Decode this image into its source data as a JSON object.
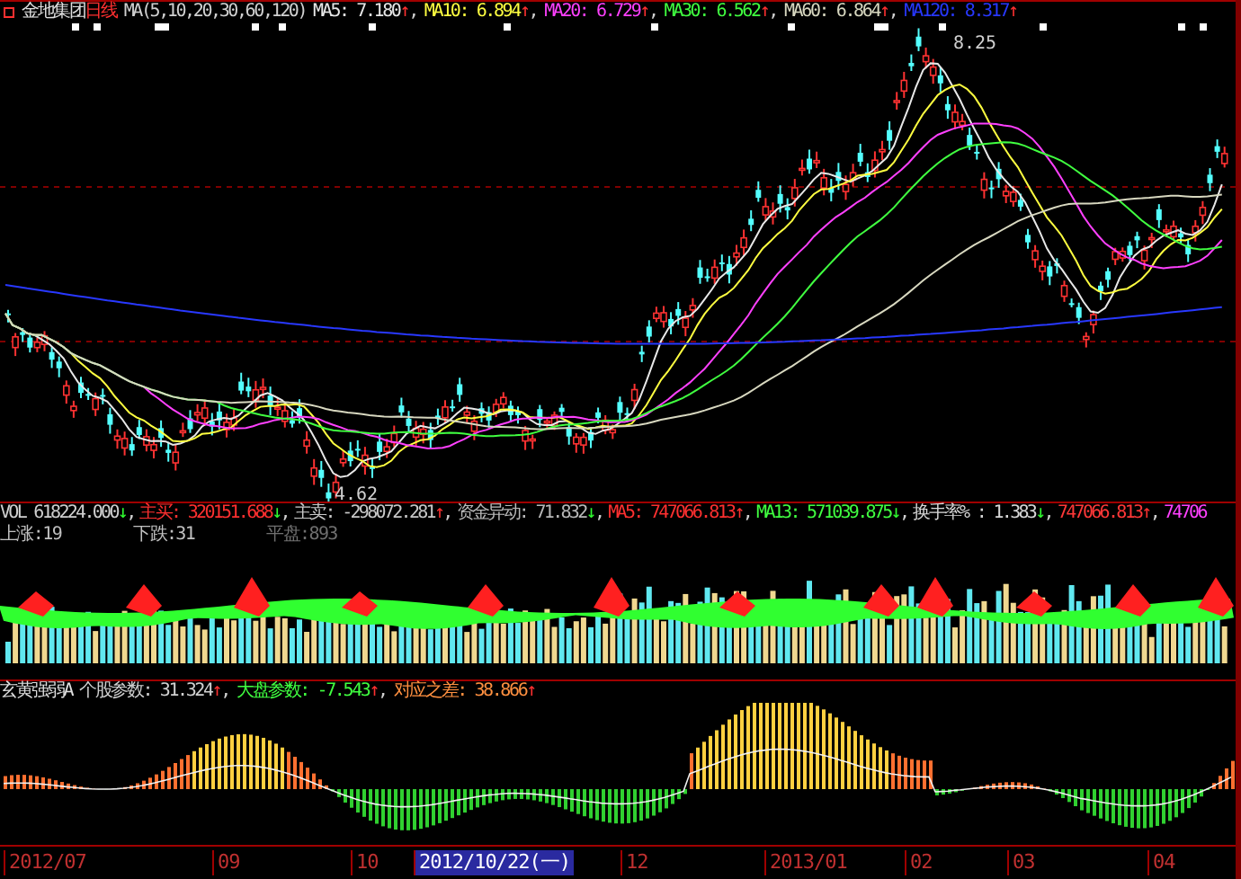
{
  "price_panel": {
    "title": {
      "name": "金地集团",
      "period": "日线",
      "params": "MA(5,10,20,30,60,120)"
    },
    "legend": [
      {
        "label": "MA5: 7.180",
        "arrow": {
          "text": "↑",
          "color": "#ff3030"
        },
        "sep": ",",
        "color": "#e8e8e8"
      },
      {
        "label": "MA10: 6.894",
        "arrow": {
          "text": "↑",
          "color": "#ff3030"
        },
        "sep": ",",
        "color": "#ffff40"
      },
      {
        "label": "MA20: 6.729",
        "arrow": {
          "text": "↑",
          "color": "#ff3030"
        },
        "sep": ",",
        "color": "#ff40ff"
      },
      {
        "label": "MA30: 6.562",
        "arrow": {
          "text": "↑",
          "color": "#ff3030"
        },
        "sep": ",",
        "color": "#40ff40"
      },
      {
        "label": "MA60: 6.864",
        "arrow": {
          "text": "↑",
          "color": "#ff3030"
        },
        "sep": ",",
        "color": "#d8d8c0"
      },
      {
        "label": "MA120: 8.317",
        "arrow": {
          "text": "↑",
          "color": "#ff3030"
        },
        "color": "#2838ff"
      }
    ],
    "annotations": [
      {
        "text": "8.25",
        "kind": "high"
      },
      {
        "text": "4.62",
        "kind": "low"
      }
    ]
  },
  "volume_panel": {
    "legend": [
      {
        "label": "VOL 618224.000",
        "arrow": {
          "text": "↓",
          "color": "#30ff30"
        },
        "sep": ",",
        "color": "#d0d0d0"
      },
      {
        "label": "主买: 320151.688",
        "arrow": {
          "text": "↓",
          "color": "#30ff30"
        },
        "sep": ",",
        "color": "#ff3030"
      },
      {
        "label": "主卖: -298072.281",
        "arrow": {
          "text": "↑",
          "color": "#ff3030"
        },
        "sep": ",",
        "color": "#c8c8c8"
      },
      {
        "label": "资金异动: 71.832",
        "arrow": {
          "text": "↓",
          "color": "#30ff30"
        },
        "sep": ",",
        "color": "#b8b8b8"
      },
      {
        "label": "MA5: 747066.813",
        "arrow": {
          "text": "↑",
          "color": "#ff3030"
        },
        "sep": ",",
        "color": "#ff3030"
      },
      {
        "label": "MA13: 571039.875",
        "arrow": {
          "text": "↓",
          "color": "#30ff30"
        },
        "sep": ",",
        "color": "#40ff40"
      },
      {
        "label": "换手率% : 1.383",
        "arrow": {
          "text": "↓",
          "color": "#30ff30"
        },
        "sep": ",",
        "color": "#d8d8d8"
      },
      {
        "label": "747066.813",
        "arrow": {
          "text": "↑",
          "color": "#ff3030"
        },
        "sep": ",",
        "color": "#ff3838"
      },
      {
        "label": "74706",
        "color": "#ff40ff"
      }
    ],
    "stats": [
      "上涨:19",
      "下跌:31",
      "平盘:893"
    ]
  },
  "indicator_panel": {
    "name": "玄黄强弱A",
    "legend": [
      {
        "label": "个股参数: 31.324",
        "arrow": {
          "text": "↑",
          "color": "#ff3030"
        },
        "sep": ",",
        "color": "#d0d0d0"
      },
      {
        "label": "大盘参数: -7.543",
        "arrow": {
          "text": "↑",
          "color": "#ff3030"
        },
        "sep": ",",
        "color": "#40ff40"
      },
      {
        "label": "对应之差: 38.866",
        "arrow": {
          "text": "↑",
          "color": "#ff3030"
        },
        "color": "#ff9040"
      }
    ]
  },
  "time_axis": [
    {
      "label": "2012/07",
      "selected": false
    },
    {
      "label": "09",
      "selected": false
    },
    {
      "label": "10",
      "selected": false
    },
    {
      "label": "2012/10/22(一)",
      "selected": true
    },
    {
      "label": "12",
      "selected": false
    },
    {
      "label": "2013/01",
      "selected": false
    },
    {
      "label": "02",
      "selected": false
    },
    {
      "label": "03",
      "selected": false
    },
    {
      "label": "04",
      "selected": false
    }
  ]
}
